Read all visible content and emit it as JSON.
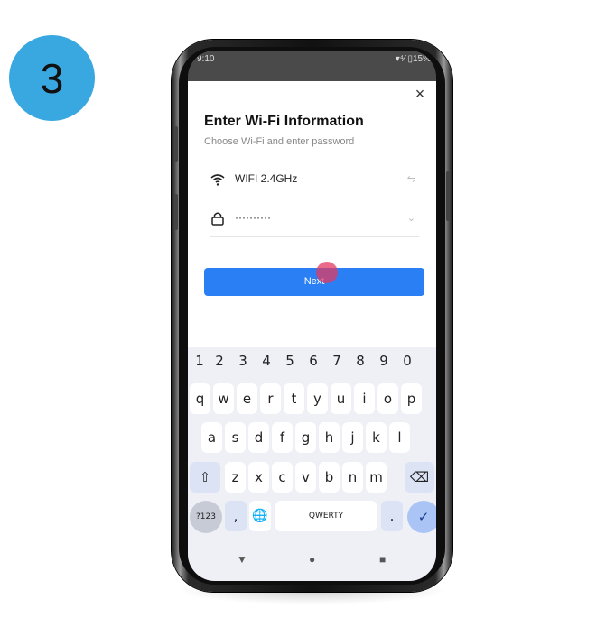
{
  "step": {
    "number": "3"
  },
  "statusbar": {
    "time": "9:10",
    "icons": "▾⁴⁄ ▯15%"
  },
  "dialog": {
    "title": "Enter Wi-Fi Information",
    "subtitle": "Choose Wi-Fi and enter password",
    "close_label": "×",
    "wifi": {
      "value": "WIFI 2.4GHz",
      "action": "⇋"
    },
    "password": {
      "value": "··········",
      "action": "⌄"
    },
    "next_label": "Next"
  },
  "keyboard": {
    "number_row": [
      "1",
      "2",
      "3",
      "4",
      "5",
      "6",
      "7",
      "8",
      "9",
      "0"
    ],
    "row1": [
      "q",
      "w",
      "e",
      "r",
      "t",
      "y",
      "u",
      "i",
      "o",
      "p"
    ],
    "row2": [
      "a",
      "s",
      "d",
      "f",
      "g",
      "h",
      "j",
      "k",
      "l"
    ],
    "row3": [
      "z",
      "x",
      "c",
      "v",
      "b",
      "n",
      "m"
    ],
    "shift": "⇧",
    "backspace": "⌫",
    "symbols": "?123",
    "comma": ",",
    "globe": "🌐",
    "space": "QWERTY",
    "period": ".",
    "enter": "✓"
  },
  "navbar": {
    "back": "▼",
    "home": "●",
    "recents": "■"
  },
  "colors": {
    "accent": "#2b7ff5",
    "badge": "#3aa8e0",
    "touch": "#e23a62"
  }
}
